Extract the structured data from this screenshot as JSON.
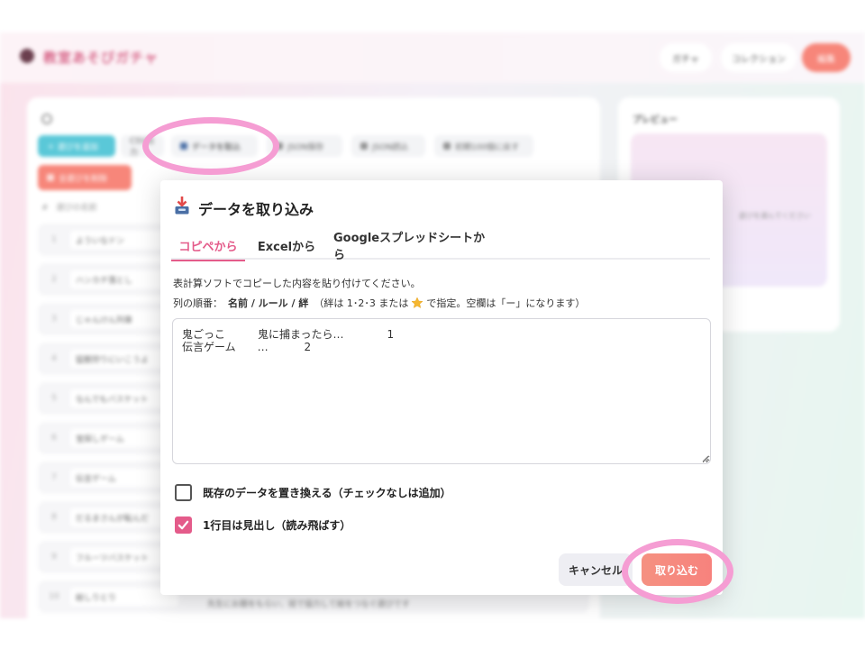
{
  "app": {
    "title": "教室あそびガチャ",
    "header_buttons": [
      "ガチャ",
      "コレクション",
      "編集"
    ],
    "toolbar": {
      "add": "＋ 遊びを追加",
      "csv": "CSV出力",
      "import": "データを取込",
      "json_save": "JSON保存",
      "json_read": "JSON読込",
      "reset": "初期100個に戻す",
      "delete_all": "全遊びを削除"
    },
    "list_header": "#　遊びの名前",
    "rows": [
      {
        "num": "1",
        "name": "よういなドン"
      },
      {
        "num": "2",
        "name": "ハンカチ落とし"
      },
      {
        "num": "3",
        "name": "じゃんけん列車"
      },
      {
        "num": "4",
        "name": "猛獣狩りにいこうよ"
      },
      {
        "num": "5",
        "name": "なんでもバスケット"
      },
      {
        "num": "6",
        "name": "宝探しゲーム"
      },
      {
        "num": "7",
        "name": "伝言ゲーム"
      },
      {
        "num": "8",
        "name": "だるまさんが転んだ"
      },
      {
        "num": "9",
        "name": "フルーツバスケット"
      },
      {
        "num": "10",
        "name": "絵しりとり"
      }
    ],
    "bottom_row_text": "先生にお題をもらい、班で協力して絵をつなぐ遊びです",
    "preview": {
      "title": "プレビュー",
      "empty_text": "遊びを選んでください"
    }
  },
  "modal": {
    "title": "データを取り込み",
    "tabs": [
      "コピペから",
      "Excelから",
      "Googleスプレッドシートから"
    ],
    "active_tab": 0,
    "description_line1": "表計算ソフトでコピーした内容を貼り付けてください。",
    "description_line2": {
      "prefix": "列の順番：",
      "columns": "名前 / ルール / 絆",
      "middle": "（絆は 1･2･3 または",
      "suffix": "で指定。空欄は「ー」になります）"
    },
    "textarea_value": "鬼ごっこ　　　鬼に捕まったら…　　　　1\n伝言ゲーム　　…　　　 2",
    "checkboxes": [
      {
        "label": "既存のデータを置き換える（チェックなしは追加）",
        "checked": false
      },
      {
        "label": "1行目は見出し（読み飛ばす）",
        "checked": true
      }
    ],
    "cancel_label": "キャンセル",
    "import_label": "取り込む"
  },
  "colors": {
    "accent_pink": "#e45b8a",
    "import_button": "#f7827d",
    "highlight_ring": "#f59dd3"
  }
}
